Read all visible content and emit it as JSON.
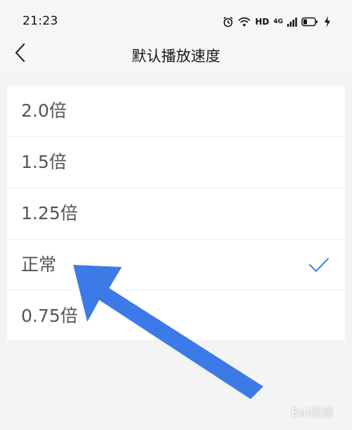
{
  "status_bar": {
    "time": "21:23",
    "network_label": "HD",
    "signal_label": "4G"
  },
  "nav": {
    "title": "默认播放速度"
  },
  "speed_options": [
    {
      "label": "2.0倍",
      "selected": false
    },
    {
      "label": "1.5倍",
      "selected": false
    },
    {
      "label": "1.25倍",
      "selected": false
    },
    {
      "label": "正常",
      "selected": true
    },
    {
      "label": "0.75倍",
      "selected": false
    }
  ],
  "colors": {
    "check": "#3e7bf3",
    "arrow": "#3c7ae8"
  },
  "watermark": {
    "text": "Bai经验"
  }
}
